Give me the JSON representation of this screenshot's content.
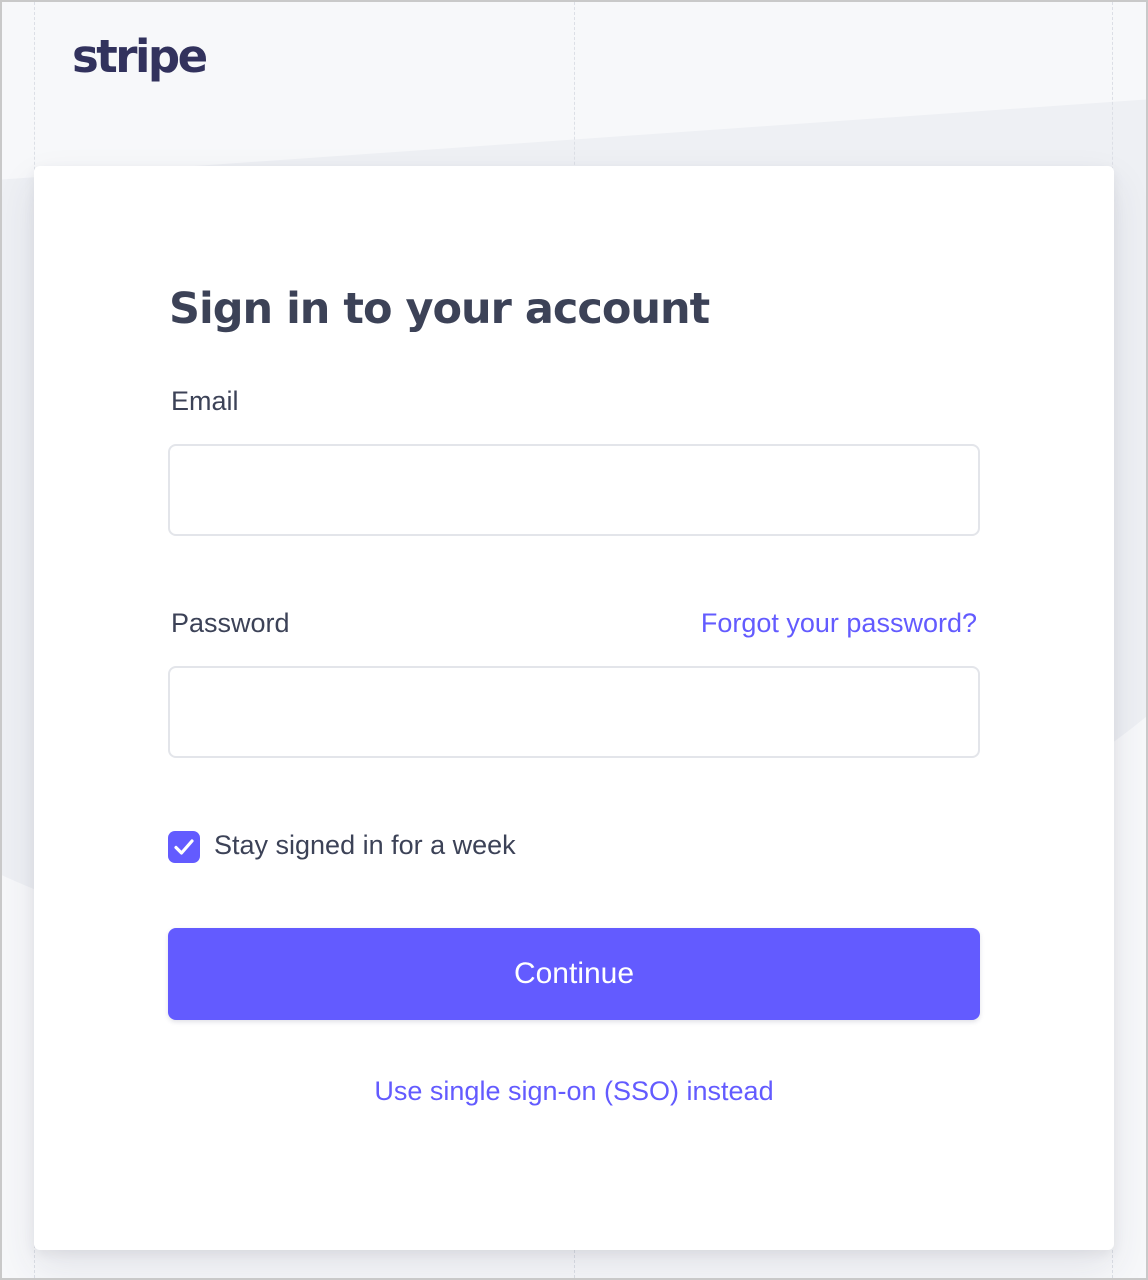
{
  "brand": {
    "logo_text": "stripe"
  },
  "signin": {
    "title": "Sign in to your account",
    "email_label": "Email",
    "email_value": "",
    "password_label": "Password",
    "password_value": "",
    "forgot_link": "Forgot your password?",
    "stay_signed_in_label": "Stay signed in for a week",
    "stay_signed_in_checked": true,
    "continue_label": "Continue",
    "sso_link": "Use single sign-on (SSO) instead"
  },
  "icons": {
    "checkbox": "check-icon"
  },
  "colors": {
    "accent": "#635bff",
    "heading": "#3c4257",
    "logo": "#32325d",
    "background": "#f7f8fa"
  }
}
